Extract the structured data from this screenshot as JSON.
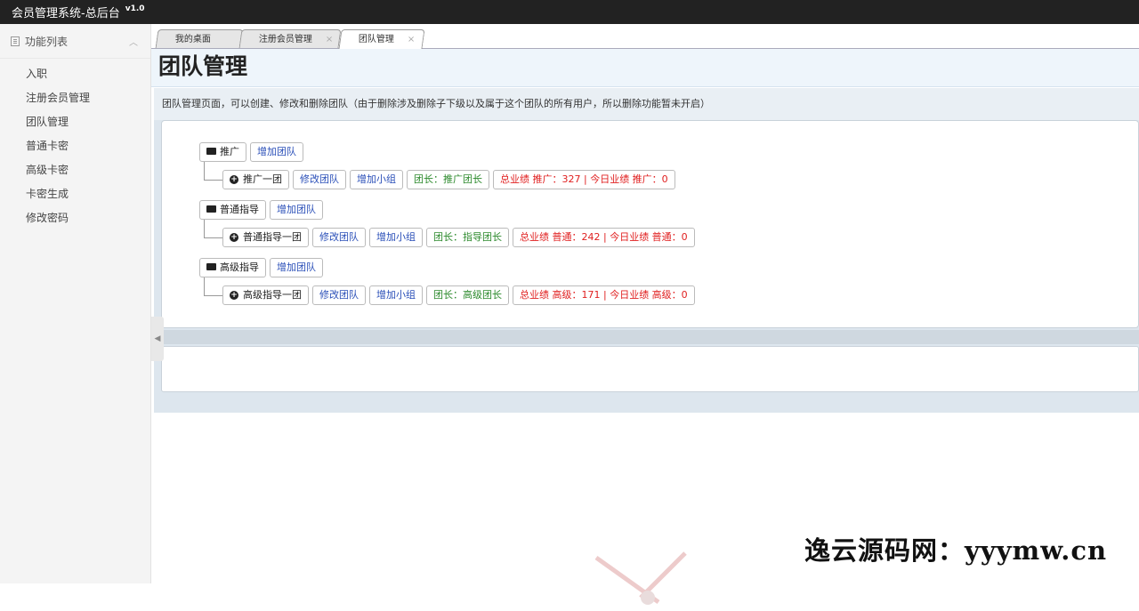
{
  "app": {
    "title": "会员管理系统-总后台",
    "version": "v1.0"
  },
  "sidebar": {
    "header": "功能列表",
    "items": [
      {
        "label": "入职"
      },
      {
        "label": "注册会员管理"
      },
      {
        "label": "团队管理"
      },
      {
        "label": "普通卡密"
      },
      {
        "label": "高级卡密"
      },
      {
        "label": "卡密生成"
      },
      {
        "label": "修改密码"
      }
    ]
  },
  "tabs": [
    {
      "label": "我的桌面",
      "closable": false
    },
    {
      "label": "注册会员管理",
      "closable": true
    },
    {
      "label": "团队管理",
      "closable": true,
      "active": true
    }
  ],
  "close_glyph": "×",
  "page": {
    "title": "团队管理",
    "description": "团队管理页面，可以创建、修改和删除团队（由于删除涉及删除子下级以及属于这个团队的所有用户，所以删除功能暂未开启）"
  },
  "groups": [
    {
      "name": "推广",
      "add_team": "增加团队",
      "team": {
        "name": "推广一团",
        "edit": "修改团队",
        "add_group": "增加小组",
        "leader": "团长：推广团长",
        "stats": "总业绩 推广：327 | 今日业绩 推广：0"
      }
    },
    {
      "name": "普通指导",
      "add_team": "增加团队",
      "team": {
        "name": "普通指导一团",
        "edit": "修改团队",
        "add_group": "增加小组",
        "leader": "团长：指导团长",
        "stats": "总业绩 普通：242 | 今日业绩 普通：0"
      }
    },
    {
      "name": "高级指导",
      "add_team": "增加团队",
      "team": {
        "name": "高级指导一团",
        "edit": "修改团队",
        "add_group": "增加小组",
        "leader": "团长：高级团长",
        "stats": "总业绩 高级：171 | 今日业绩 高级：0"
      }
    }
  ],
  "watermark": "逸云源码网：yyymw.cn"
}
